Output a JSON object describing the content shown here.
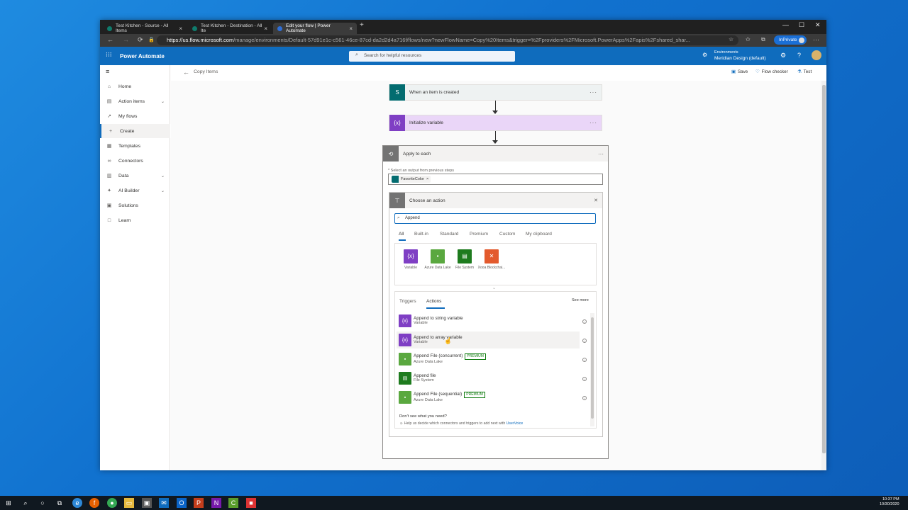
{
  "browser": {
    "tabs": [
      {
        "title": "Test Kitchen - Source - All Items"
      },
      {
        "title": "Test Kitchen - Destination - All Ite"
      },
      {
        "title": "Edit your flow | Power Automate"
      }
    ],
    "new_tab": "+",
    "url_host": "https://us.flow.microsoft.com",
    "url_path": "/manage/environments/Default-57d91e1c-c561-46ce-87cd-da2d2d4a716f/flows/new?newFlowName=Copy%20Items&trigger=%2Fproviders%2FMicrosoft.PowerApps%2Fapis%2Fshared_shar...",
    "inprivate": "InPrivate",
    "window_controls": [
      "—",
      "☐",
      "✕"
    ]
  },
  "app": {
    "name": "Power Automate",
    "search_placeholder": "Search for helpful resources",
    "env_label": "Environments",
    "env_name": "Meridian Design (default)"
  },
  "nav": [
    {
      "label": "Home",
      "icon": "home-icon",
      "chev": false,
      "active": false
    },
    {
      "label": "Action items",
      "icon": "clipboard-icon",
      "chev": true,
      "active": false
    },
    {
      "label": "My flows",
      "icon": "flows-icon",
      "chev": false,
      "active": false
    },
    {
      "label": "Create",
      "icon": "plus-icon",
      "chev": false,
      "active": true
    },
    {
      "label": "Templates",
      "icon": "templates-icon",
      "chev": false,
      "active": false
    },
    {
      "label": "Connectors",
      "icon": "connector-icon",
      "chev": false,
      "active": false
    },
    {
      "label": "Data",
      "icon": "data-icon",
      "chev": true,
      "active": false
    },
    {
      "label": "AI Builder",
      "icon": "ai-builder-icon",
      "chev": true,
      "active": false
    },
    {
      "label": "Solutions",
      "icon": "solutions-icon",
      "chev": false,
      "active": false
    },
    {
      "label": "Learn",
      "icon": "learn-icon",
      "chev": false,
      "active": false
    }
  ],
  "cmdbar": {
    "flow_name": "Copy Items",
    "save": "Save",
    "checker": "Flow checker",
    "test": "Test"
  },
  "flow": {
    "trigger": "When an item is created",
    "init": "Initialize variable",
    "apply": "Apply to each",
    "select_label": "* Select an output from previous steps",
    "token": "FavoriteColor",
    "token_x": "×"
  },
  "chooser": {
    "title": "Choose an action",
    "close": "✕",
    "search_value": "Append",
    "tabs": [
      "All",
      "Built-in",
      "Standard",
      "Premium",
      "Custom",
      "My clipboard"
    ],
    "connectors": [
      {
        "name": "Variable",
        "color": "#7f3fc4"
      },
      {
        "name": "Azure Data Lake",
        "color": "#5aa83f"
      },
      {
        "name": "File System",
        "color": "#1e7b1e"
      },
      {
        "name": "Xooa Blockchai...",
        "color": "#e35a2d"
      }
    ],
    "expand": "⌄",
    "action_tabs": [
      "Triggers",
      "Actions"
    ],
    "see_more": "See more",
    "actions": [
      {
        "title": "Append to string variable",
        "sub": "Variable",
        "premium": "",
        "color": "#7f3fc4"
      },
      {
        "title": "Append to array variable",
        "sub": "Variable",
        "premium": "",
        "color": "#7f3fc4"
      },
      {
        "title": "Append File (concurrent)",
        "sub": "Azure Data Lake",
        "premium": "PREMIUM",
        "color": "#5aa83f"
      },
      {
        "title": "Append file",
        "sub": "File System",
        "premium": "",
        "color": "#1e7b1e"
      },
      {
        "title": "Append File (sequential)",
        "sub": "Azure Data Lake",
        "premium": "PREMIUM",
        "color": "#5aa83f"
      }
    ],
    "dont_see": "Don't see what you need?",
    "help_text": "Help us decide which connectors and triggers to add next with",
    "help_link": "UserVoice"
  },
  "colors": {
    "brand": "#0f6cbd",
    "sharepoint": "#036c70",
    "variable": "#7f3fc4",
    "init_bg": "#ead6f8"
  },
  "taskbar": {
    "time": "10:37 PM",
    "date": "10/30/2020"
  }
}
